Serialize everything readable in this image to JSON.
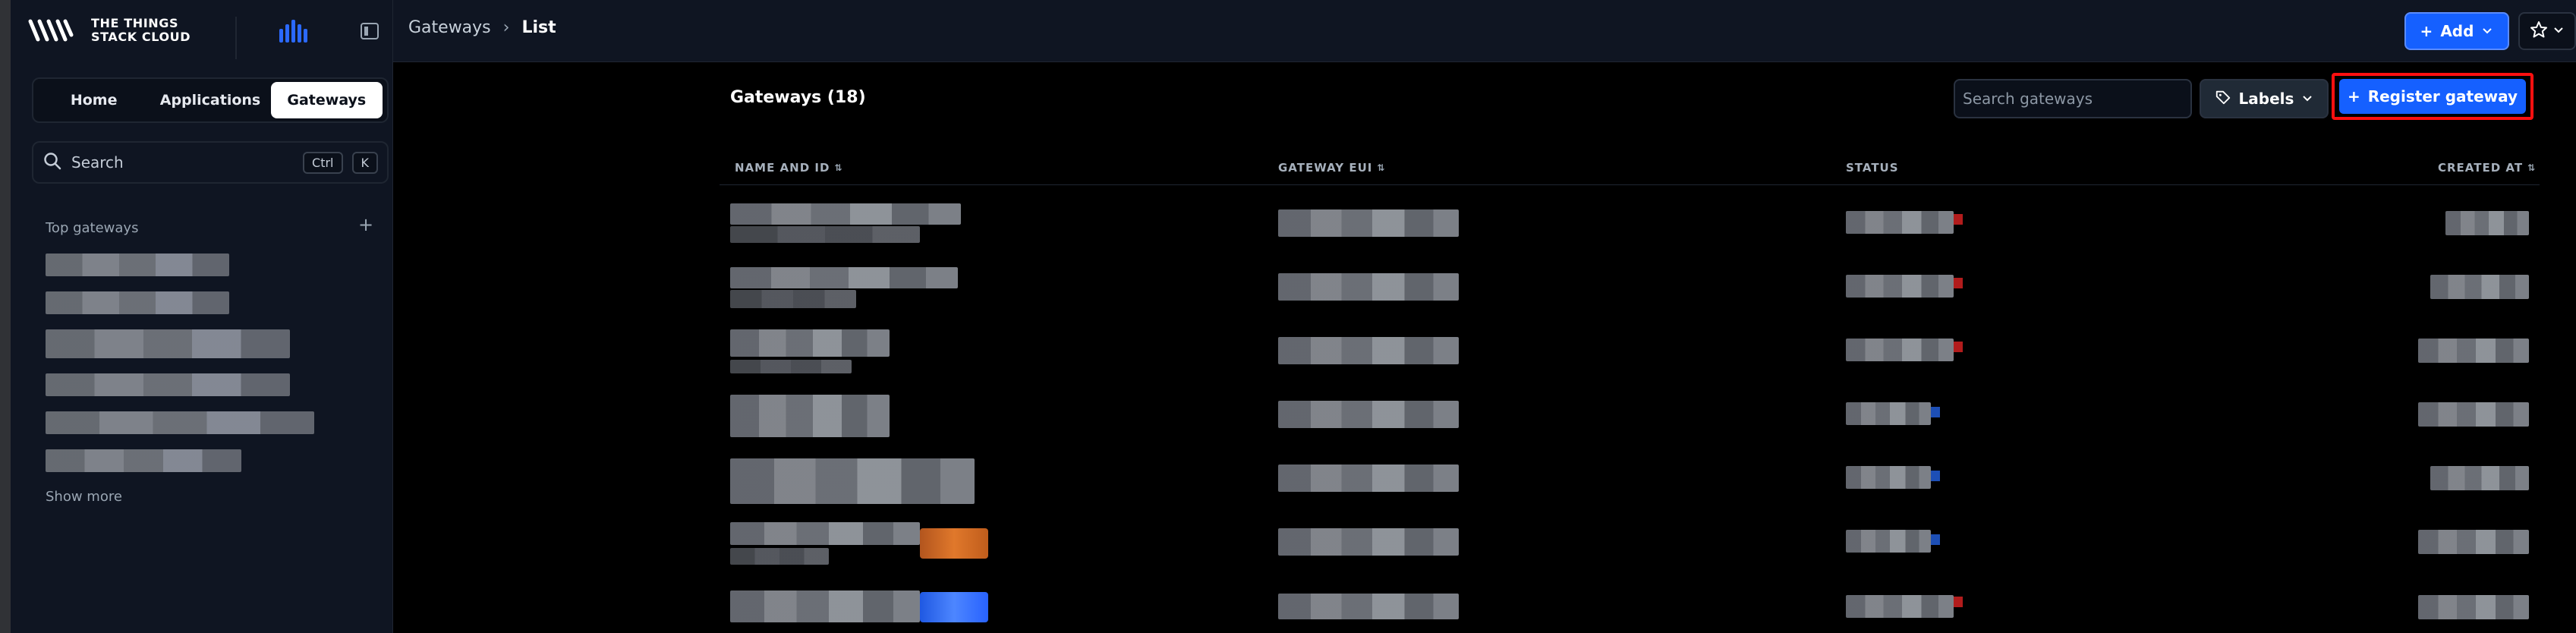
{
  "brand": {
    "name": "THE THINGS STACK CLOUD"
  },
  "nav": {
    "tabs": [
      {
        "label": "Home"
      },
      {
        "label": "Applications"
      },
      {
        "label": "Gateways"
      }
    ],
    "active_tab": "Gateways"
  },
  "sidebar": {
    "search_label": "Search",
    "shortcut_keys": [
      "Ctrl",
      "K"
    ],
    "section_title": "Top gateways",
    "show_more_label": "Show more"
  },
  "breadcrumb": {
    "items": [
      "Gateways",
      "List"
    ]
  },
  "topbar": {
    "add_label": "Add"
  },
  "content": {
    "title": "Gateways (18)",
    "search_placeholder": "Search gateways",
    "labels_button": "Labels",
    "register_button": "Register gateway"
  },
  "table": {
    "columns": [
      "NAME AND ID",
      "GATEWAY EUI",
      "STATUS",
      "CREATED AT"
    ]
  },
  "colors": {
    "accent": "#1560ff",
    "sidebar_bg": "#0f1522",
    "highlight_outline": "#ff1010",
    "status_red": "#b21c1c",
    "status_blue": "#1d4fb6"
  }
}
